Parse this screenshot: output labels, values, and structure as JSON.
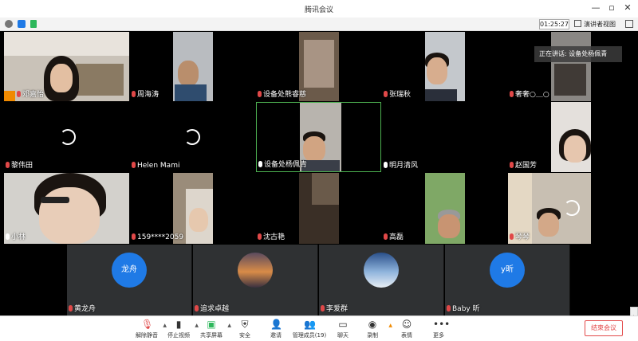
{
  "window": {
    "title": "腾讯会议",
    "controls": [
      "—",
      "▫",
      "✕"
    ]
  },
  "infobar": {
    "timer": "01:25:27",
    "view_label": "演讲者视图"
  },
  "speaking_tip": "正在讲话: 设备处杨佩青",
  "tiles": [
    {
      "name": "邓嘉怡",
      "muted": true
    },
    {
      "name": "周海涛",
      "muted": true
    },
    {
      "name": "设备处熊睿慈",
      "muted": true
    },
    {
      "name": "张瑞秋",
      "muted": true
    },
    {
      "name": "奢奢○＿○",
      "muted": true
    },
    {
      "name": "黎伟田",
      "muted": true
    },
    {
      "name": "Helen Mami",
      "muted": true
    },
    {
      "name": "设备处杨佩青",
      "muted": false
    },
    {
      "name": "明月清风",
      "muted": false
    },
    {
      "name": "赵国芳",
      "muted": true
    },
    {
      "name": "小林",
      "muted": false
    },
    {
      "name": "159****2059",
      "muted": true
    },
    {
      "name": "沈古艳",
      "muted": true
    },
    {
      "name": "高磊",
      "muted": true
    },
    {
      "name": "琴琴",
      "muted": true
    }
  ],
  "avatar_tiles": [
    {
      "name": "黄龙舟",
      "avatar_text": "龙舟",
      "color": "#1f7ae6"
    },
    {
      "name": "追求卓越",
      "avatar_text": "",
      "color": "#c9874a"
    },
    {
      "name": "李爱群",
      "avatar_text": "",
      "color": "#5a86b8"
    },
    {
      "name": "Baby 昕",
      "avatar_text": "y昕",
      "color": "#1f7ae6"
    }
  ],
  "toolbar": {
    "unmute": "解除静音",
    "stop_video": "停止视频",
    "share_screen": "共享屏幕",
    "security": "安全",
    "invite": "邀请",
    "members": "管理成员(19)",
    "chat": "聊天",
    "record": "录制",
    "reactions": "表情",
    "more": "更多",
    "end": "结束会议"
  },
  "colors": {
    "accent": "#1f7ae6",
    "end": "#e34b4b",
    "speaking_border": "#4caf50"
  }
}
